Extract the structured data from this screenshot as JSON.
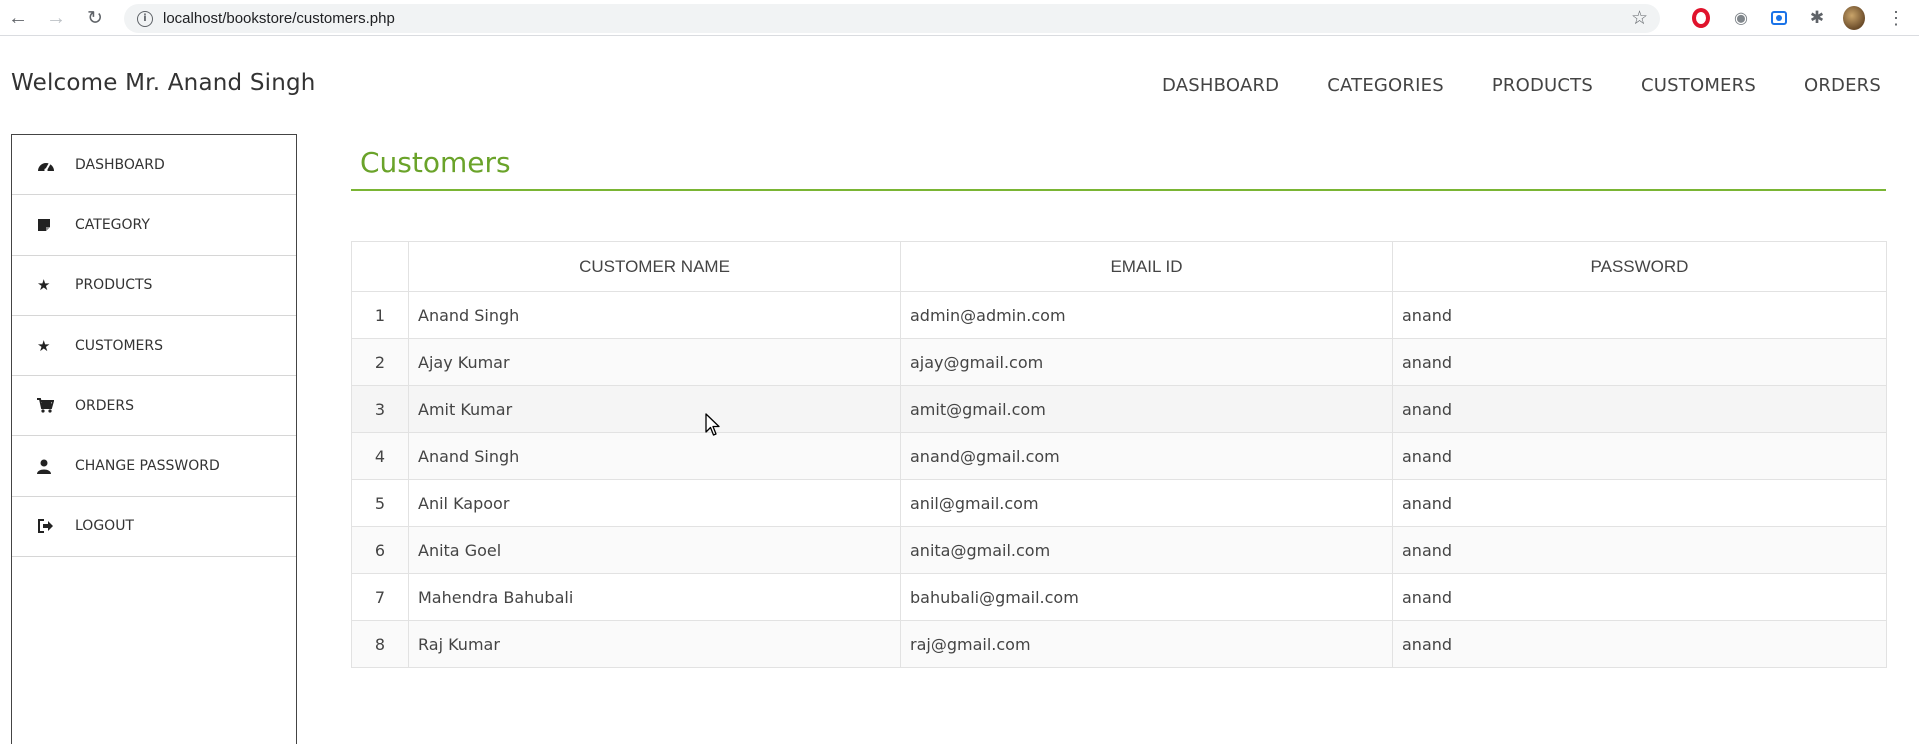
{
  "browser": {
    "url": "localhost/bookstore/customers.php"
  },
  "header": {
    "welcome": "Welcome Mr. Anand Singh",
    "nav": [
      "DASHBOARD",
      "CATEGORIES",
      "PRODUCTS",
      "CUSTOMERS",
      "ORDERS"
    ]
  },
  "sidebar": {
    "items": [
      {
        "label": "DASHBOARD",
        "icon": "dashboard-icon"
      },
      {
        "label": "CATEGORY",
        "icon": "category-icon"
      },
      {
        "label": "PRODUCTS",
        "icon": "star-icon"
      },
      {
        "label": "CUSTOMERS",
        "icon": "star-icon"
      },
      {
        "label": "ORDERS",
        "icon": "cart-icon"
      },
      {
        "label": "CHANGE PASSWORD",
        "icon": "user-icon"
      },
      {
        "label": "LOGOUT",
        "icon": "logout-icon"
      }
    ]
  },
  "main": {
    "title": "Customers",
    "accent_color": "#6aa32a",
    "table": {
      "headers": [
        "",
        "CUSTOMER NAME",
        "EMAIL ID",
        "PASSWORD"
      ],
      "rows": [
        [
          "1",
          "Anand Singh",
          "admin@admin.com",
          "anand"
        ],
        [
          "2",
          "Ajay Kumar",
          "ajay@gmail.com",
          "anand"
        ],
        [
          "3",
          "Amit Kumar",
          "amit@gmail.com",
          "anand"
        ],
        [
          "4",
          "Anand Singh",
          "anand@gmail.com",
          "anand"
        ],
        [
          "5",
          "Anil Kapoor",
          "anil@gmail.com",
          "anand"
        ],
        [
          "6",
          "Anita Goel",
          "anita@gmail.com",
          "anand"
        ],
        [
          "7",
          "Mahendra Bahubali",
          "bahubali@gmail.com",
          "anand"
        ],
        [
          "8",
          "Raj Kumar",
          "raj@gmail.com",
          "anand"
        ]
      ]
    }
  }
}
